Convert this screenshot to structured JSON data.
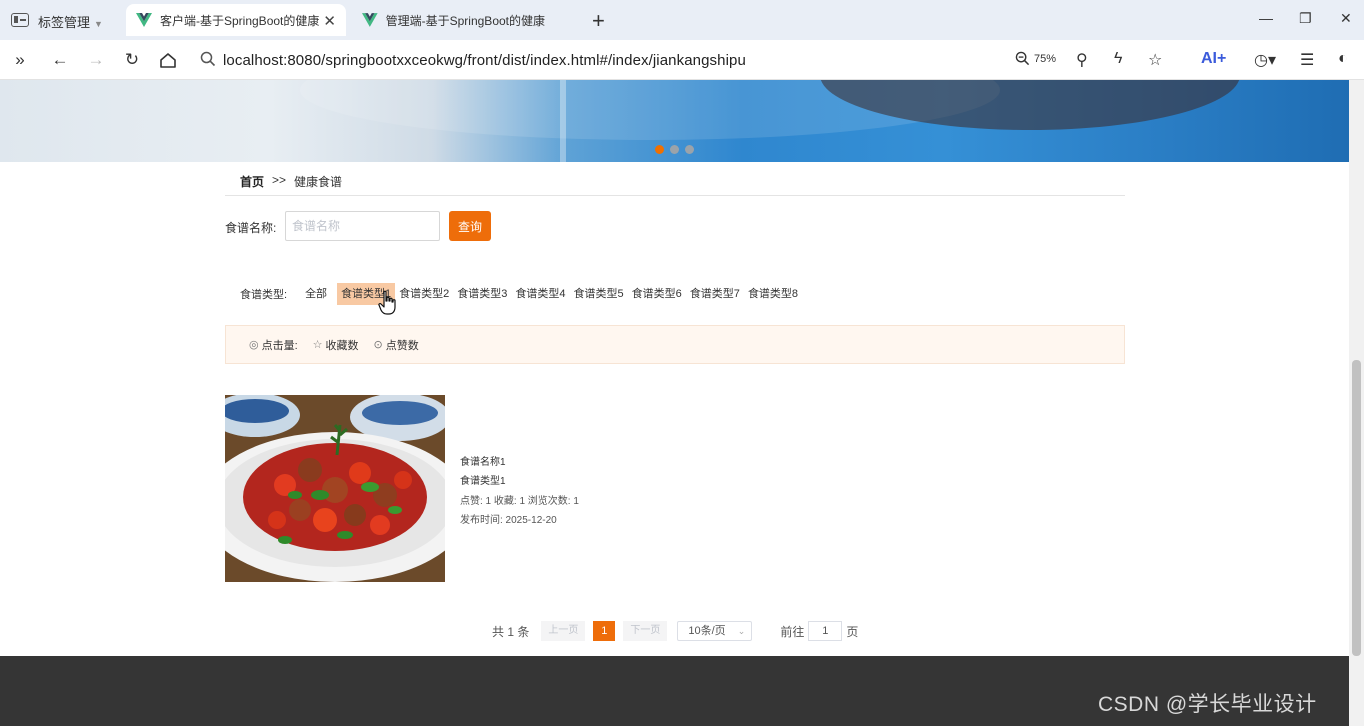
{
  "browser": {
    "tab_group_label": "标签管理",
    "tabs": [
      {
        "title": "客户端-基于SpringBoot的健康",
        "active": true
      },
      {
        "title": "管理端-基于SpringBoot的健康",
        "active": false
      }
    ],
    "url": "localhost:8080/springbootxxceokwg/front/dist/index.html#/index/jiankangshipu",
    "zoom": "75%"
  },
  "breadcrumb": {
    "home": "首页",
    "separator": ">>",
    "current": "健康食谱"
  },
  "search": {
    "label": "食谱名称:",
    "placeholder": "食谱名称",
    "value": "",
    "button": "查询"
  },
  "categories": {
    "label": "食谱类型:",
    "items": [
      "全部",
      "食谱类型1",
      "食谱类型2",
      "食谱类型3",
      "食谱类型4",
      "食谱类型5",
      "食谱类型6",
      "食谱类型7",
      "食谱类型8"
    ],
    "selected": "食谱类型1"
  },
  "sort": {
    "items": [
      {
        "label": "点击量:",
        "icon": "eye-icon"
      },
      {
        "label": "收藏数",
        "icon": "star-icon"
      },
      {
        "label": "点赞数",
        "icon": "like-icon"
      }
    ]
  },
  "recipes": [
    {
      "name": "食谱名称1",
      "type": "食谱类型1",
      "stats": "点赞: 1  收藏: 1  浏览次数: 1",
      "published": "发布时间: 2025-12-20"
    }
  ],
  "pagination": {
    "total": "共 1 条",
    "prev": "上一页",
    "current": "1",
    "next": "下一页",
    "page_size": "10条/页",
    "goto_label": "前往",
    "goto_value": "1",
    "page_unit": "页"
  },
  "watermark": "CSDN @学长毕业设计",
  "colors": {
    "accent": "#ee6d0a",
    "selected_category_bg": "#f8c9a3",
    "footer": "#353535"
  }
}
